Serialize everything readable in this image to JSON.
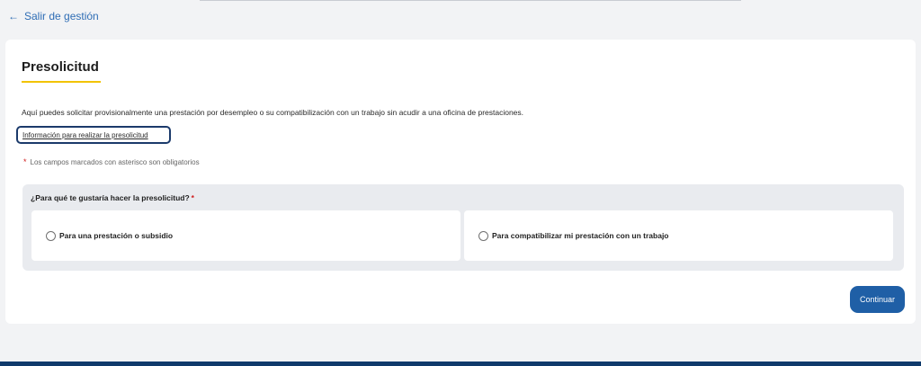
{
  "nav": {
    "back_label": "Salir de gestión"
  },
  "page": {
    "title": "Presolicitud",
    "intro": "Aquí puedes solicitar provisionalmente una prestación por desempleo o su compatibilización con un trabajo sin acudir a una oficina de prestaciones.",
    "info_link": "Información para realizar la presolicitud",
    "required_note": "Los campos marcados con asterisco son obligatorios"
  },
  "form": {
    "question": "¿Para qué te gustaría hacer la presolicitud?",
    "required_mark": "*",
    "options": [
      {
        "label": "Para una prestación o subsidio",
        "selected": false
      },
      {
        "label": "Para compatibilizar mi prestación con un trabajo",
        "selected": false
      }
    ],
    "continue_label": "Continuar"
  },
  "icons": {
    "back": "arrow-left-icon",
    "required": "asterisk-icon"
  },
  "colors": {
    "link": "#2f6db5",
    "accent_underline": "#f2c300",
    "primary_button": "#1f5fa6",
    "required": "#d01b1b",
    "focus_outline": "#1b3a6b"
  }
}
